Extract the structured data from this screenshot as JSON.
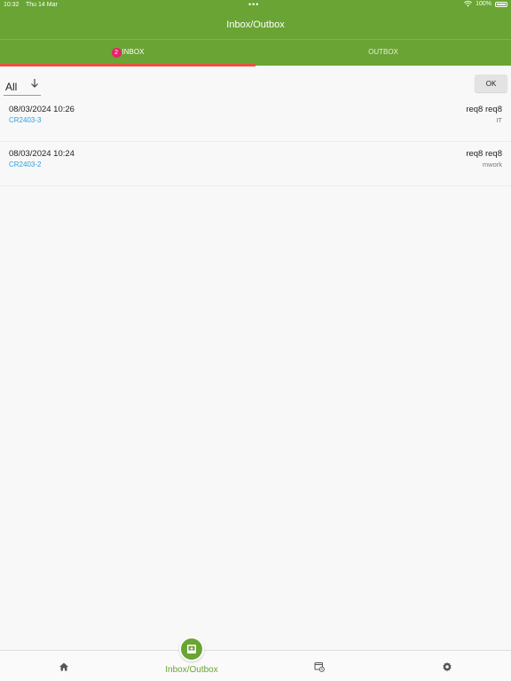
{
  "status_bar": {
    "time": "10:32",
    "date": "Thu 14 Mar",
    "dots": "•••",
    "battery": "100%"
  },
  "header": {
    "title": "Inbox/Outbox"
  },
  "tabs": [
    {
      "label": "INBOX",
      "badge": "2"
    },
    {
      "label": "OUTBOX"
    }
  ],
  "filter": {
    "value": "All"
  },
  "ok_button": {
    "label": "OK"
  },
  "items": [
    {
      "date": "08/03/2024 10:26",
      "ref": "CR2403-3",
      "user": "req8 req8",
      "dept": "IT"
    },
    {
      "date": "08/03/2024 10:24",
      "ref": "CR2403-2",
      "user": "req8 req8",
      "dept": "mwork"
    }
  ],
  "bottom_nav": {
    "items": [
      {
        "icon": "home-icon"
      },
      {
        "icon": "inbox-icon",
        "label": "Inbox/Outbox",
        "active": true
      },
      {
        "icon": "history-icon"
      },
      {
        "icon": "gear-icon"
      }
    ]
  },
  "colors": {
    "primary": "#6aa434",
    "tab_indicator": "#e8513f",
    "badge": "#e8226a",
    "link": "#2f9fdf"
  }
}
